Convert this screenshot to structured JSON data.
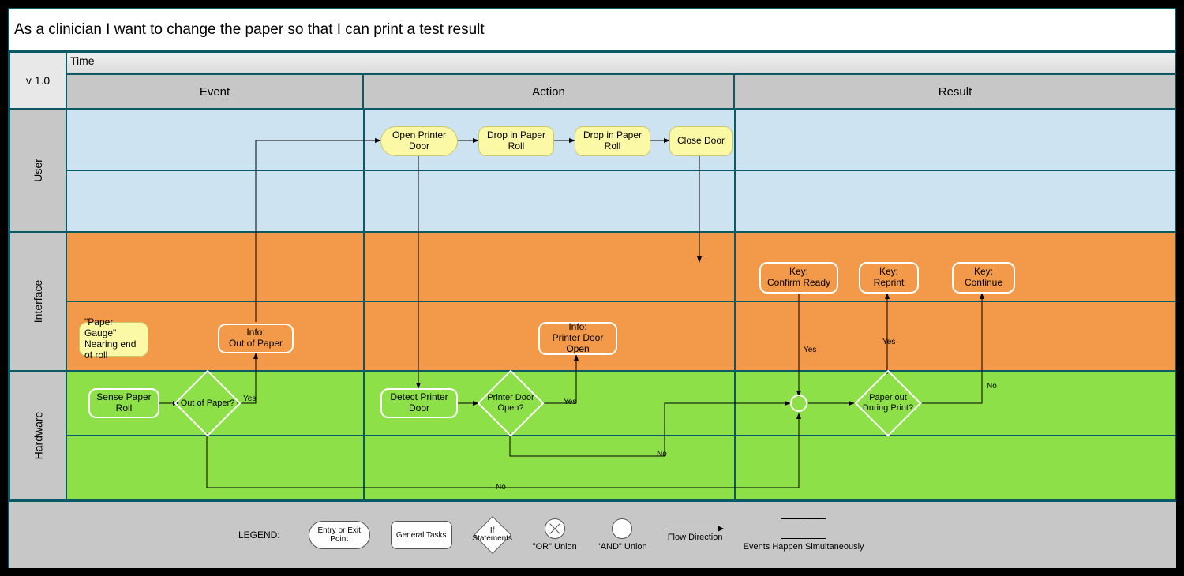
{
  "title": "As a clinician I want to change the paper so that I can print a test result",
  "version": "v 1.0",
  "time_label": "Time",
  "columns": {
    "event": "Event",
    "action": "Action",
    "result": "Result"
  },
  "lanes": {
    "user": "User",
    "interface": "Interface",
    "hardware": "Hardware"
  },
  "nodes": {
    "paper_gauge": "\"Paper Gauge\" Nearing end of roll",
    "sense_paper": "Sense Paper Roll",
    "out_of_paper_q": "Out of Paper?",
    "info_out_of_paper": "Info:\nOut of Paper",
    "open_printer_door": "Open Printer Door",
    "drop_paper_1": "Drop in Paper Roll",
    "drop_paper_2": "Drop in Paper Roll",
    "close_door": "Close Door",
    "detect_printer_door": "Detect Printer Door",
    "printer_door_open_q": "Printer Door Open?",
    "info_door_open": "Info:\nPrinter Door Open",
    "key_confirm": "Key:\nConfirm Ready",
    "key_reprint": "Key:\nReprint",
    "key_continue": "Key:\nContinue",
    "paper_out_during_q": "Paper out During Print?"
  },
  "edge_labels": {
    "yes": "Yes",
    "no": "No"
  },
  "legend": {
    "title": "LEGEND:",
    "entry": "Entry or Exit Point",
    "task": "General Tasks",
    "ifstmt": "If Statements",
    "or": "\"OR\" Union",
    "and": "\"AND\" Union",
    "flow": "Flow Direction",
    "sim": "Events Happen Simultaneously"
  }
}
